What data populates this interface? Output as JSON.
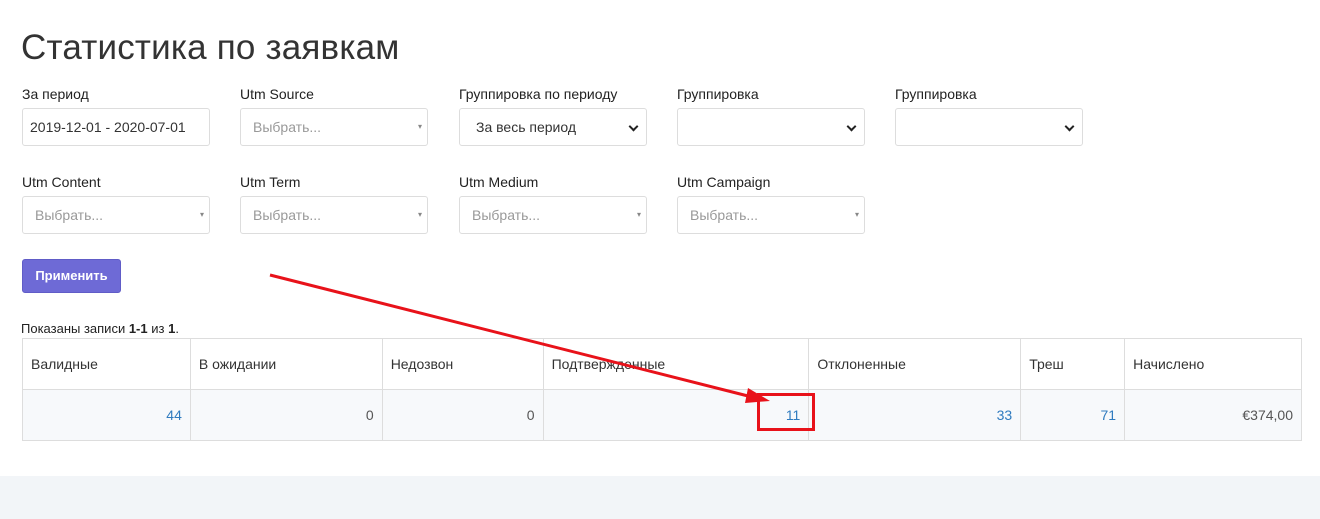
{
  "page": {
    "title": "Статистика по заявкам"
  },
  "filters": {
    "period": {
      "label": "За период",
      "value": "2019-12-01 - 2020-07-01"
    },
    "utm_source": {
      "label": "Utm Source",
      "placeholder": "Выбрать..."
    },
    "group_by_period": {
      "label": "Группировка по периоду",
      "value": "За весь период"
    },
    "grouping_1": {
      "label": "Группировка",
      "value": ""
    },
    "grouping_2": {
      "label": "Группировка",
      "value": ""
    },
    "utm_content": {
      "label": "Utm Content",
      "placeholder": "Выбрать..."
    },
    "utm_term": {
      "label": "Utm Term",
      "placeholder": "Выбрать..."
    },
    "utm_medium": {
      "label": "Utm Medium",
      "placeholder": "Выбрать..."
    },
    "utm_campaign": {
      "label": "Utm Campaign",
      "placeholder": "Выбрать..."
    },
    "caret_glyph": "▾"
  },
  "actions": {
    "apply_label": "Применить"
  },
  "summary": {
    "prefix": "Показаны записи ",
    "range": "1-1",
    "middle": " из ",
    "total": "1",
    "suffix": "."
  },
  "table": {
    "columns": [
      "Валидные",
      "В ожидании",
      "Недозвон",
      "Подтвержденные",
      "Отклоненные",
      "Треш",
      "Начислено"
    ],
    "row": [
      "44",
      "0",
      "0",
      "11",
      "33",
      "71",
      "€374,00"
    ]
  },
  "colors": {
    "accent": "#6e6ad6",
    "link": "#2f7bbf",
    "annotation": "#e8121a"
  }
}
